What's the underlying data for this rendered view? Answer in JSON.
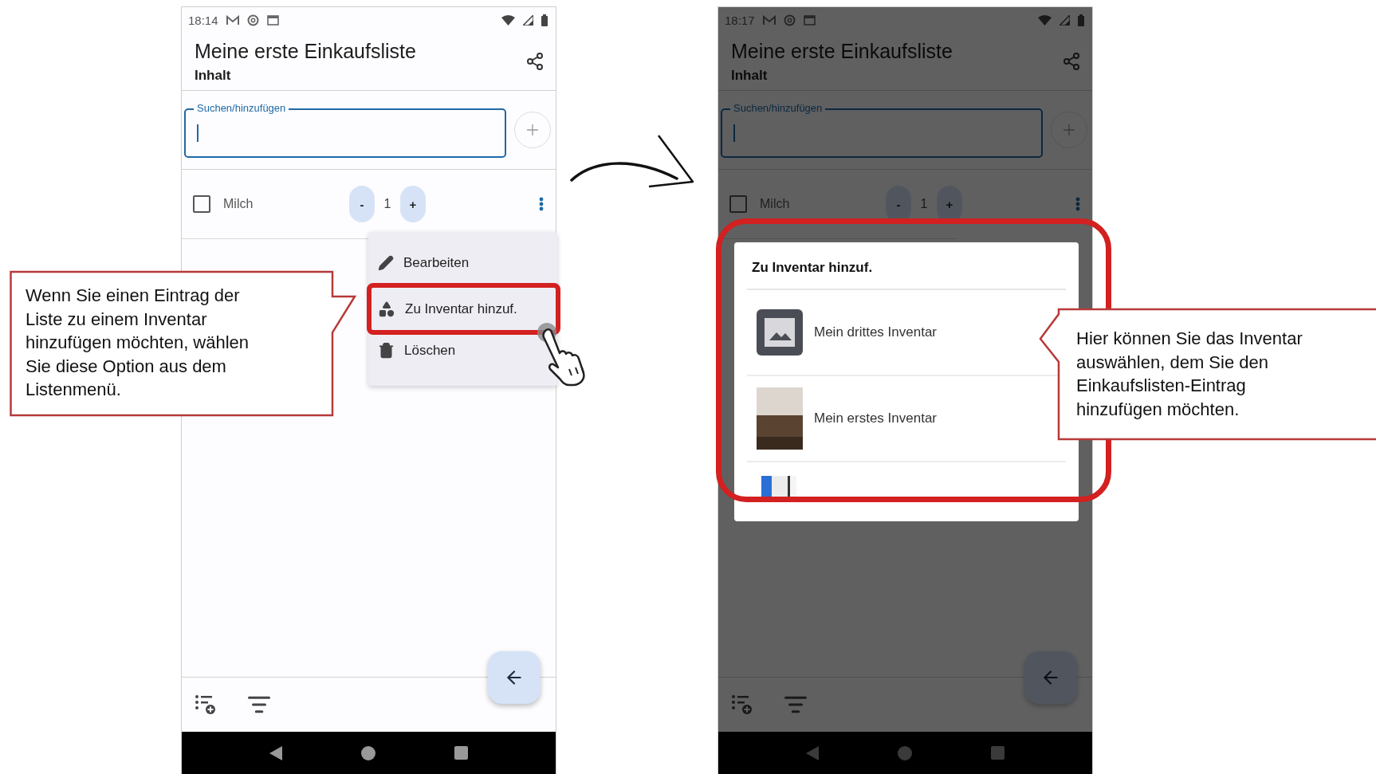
{
  "phones": [
    {
      "status_time": "18:14",
      "title": "Meine erste Einkaufsliste",
      "subtitle": "Inhalt",
      "search": {
        "label": "Suchen/hinzufügen",
        "focused": true
      },
      "items": [
        {
          "name": "Milch",
          "checked": false,
          "minus": "-",
          "quantity": "1",
          "plus": "+"
        }
      ],
      "menu": {
        "items": [
          {
            "kind": "edit",
            "label": "Bearbeiten",
            "highlighted": false
          },
          {
            "kind": "inventory",
            "label": "Zu Inventar hinzuf.",
            "highlighted": true
          },
          {
            "kind": "delete",
            "label": "Löschen",
            "highlighted": false
          }
        ]
      }
    },
    {
      "status_time": "18:17",
      "title": "Meine erste Einkaufsliste",
      "subtitle": "Inhalt",
      "dimmed": true,
      "search": {
        "label": "Suchen/hinzufügen",
        "focused": true
      },
      "items": [
        {
          "name": "Milch",
          "checked": false,
          "minus": "-",
          "quantity": "1",
          "plus": "+"
        }
      ],
      "dialog": {
        "title": "Zu Inventar hinzuf.",
        "highlighted": true,
        "items": [
          {
            "kind": "placeholder",
            "label": "Mein drittes Inventar"
          },
          {
            "kind": "photo",
            "label": "Mein erstes Inventar"
          },
          {
            "kind": "partial"
          }
        ]
      }
    }
  ],
  "callouts": [
    {
      "kind": "pointer-right",
      "text": "Wenn Sie einen Eintrag der Liste zu einem Inventar hinzufügen möchten, wählen Sie diese Option aus dem Listenmenü."
    },
    {
      "kind": "pointer-left",
      "text": "Hier können Sie das Inventar auswählen, dem Sie den Einkaufslisten-Eintrag hinzufügen möchten."
    }
  ]
}
